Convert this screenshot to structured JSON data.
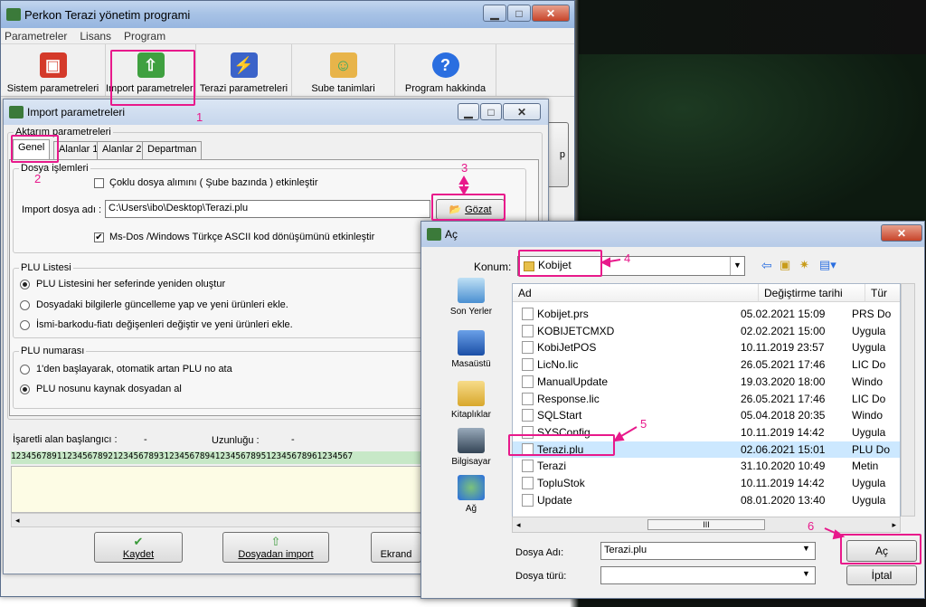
{
  "main_window": {
    "title": "Perkon Terazi yönetim programi",
    "menu": [
      "Parametreler",
      "Lisans",
      "Program"
    ],
    "toolbar": [
      {
        "label": "Sistem parametreleri",
        "icon": "toolbox-icon"
      },
      {
        "label": "Import parametreleri",
        "icon": "import-arrow-icon"
      },
      {
        "label": "Terazi parametreleri",
        "icon": "scale-plug-icon"
      },
      {
        "label": "Sube tanimlari",
        "icon": "users-icon"
      },
      {
        "label": "Program hakkinda",
        "icon": "help-icon"
      }
    ],
    "edge_button_label": "p"
  },
  "import_window": {
    "title": "Import parametreleri",
    "group_title": "Aktarım parametreleri",
    "tabs": [
      "Genel",
      "Alanlar 1",
      "Alanlar 2",
      "Departman"
    ],
    "dosya": {
      "title": "Dosya işlemleri",
      "multi_file_label": "Çoklu dosya alımını ( Şube bazında ) etkinleştir",
      "import_file_label": "Import dosya adı :",
      "import_file_value": "C:\\Users\\ibo\\Desktop\\Terazi.plu",
      "browse_label": "Gözat",
      "msdos_label": "Ms-Dos /Windows Türkçe ASCII kod dönüşümünü etkinleştir"
    },
    "plu_list": {
      "title": "PLU Listesi",
      "options": [
        "PLU Listesini her seferinde yeniden oluştur",
        "Dosyadaki bilgilerle güncelleme yap ve yeni ürünleri ekle.",
        "İsmi-barkodu-fiatı değişenleri değiştir ve yeni ürünleri ekle."
      ]
    },
    "plu_num": {
      "title": "PLU numarası",
      "options": [
        "1'den başlayarak, otomatik artan PLU no ata",
        "PLU nosunu kaynak dosyadan al"
      ]
    },
    "field_start_label": "İşaretli alan başlangıcı :",
    "field_start_value": "-",
    "length_label": "Uzunluğu :",
    "length_value": "-",
    "ruler": "1234567891123456789212345678931234567894123456789512345678961234567",
    "buttons": {
      "save": "Kaydet",
      "import": "Dosyadan import",
      "screen": "Ekrand"
    }
  },
  "open_dialog": {
    "title": "Aç",
    "location_label": "Konum:",
    "location_value": "Kobijet",
    "places": [
      "Son Yerler",
      "Masaüstü",
      "Kitaplıklar",
      "Bilgisayar",
      "Ağ"
    ],
    "columns": [
      "Ad",
      "Değiştirme tarihi",
      "Tür"
    ],
    "files": [
      {
        "name": "Kobijet.prs",
        "date": "05.02.2021 15:09",
        "type": "PRS Do"
      },
      {
        "name": "KOBIJETCMXD",
        "date": "02.02.2021 15:00",
        "type": "Uygula"
      },
      {
        "name": "KobiJetPOS",
        "date": "10.11.2019 23:57",
        "type": "Uygula"
      },
      {
        "name": "LicNo.lic",
        "date": "26.05.2021 17:46",
        "type": "LIC Do"
      },
      {
        "name": "ManualUpdate",
        "date": "19.03.2020 18:00",
        "type": "Windo"
      },
      {
        "name": "Response.lic",
        "date": "26.05.2021 17:46",
        "type": "LIC Do"
      },
      {
        "name": "SQLStart",
        "date": "05.04.2018 20:35",
        "type": "Windo"
      },
      {
        "name": "SYSConfig",
        "date": "10.11.2019 14:42",
        "type": "Uygula"
      },
      {
        "name": "Terazi.plu",
        "date": "02.06.2021 15:01",
        "type": "PLU Do"
      },
      {
        "name": "Terazi",
        "date": "31.10.2020 10:49",
        "type": "Metin"
      },
      {
        "name": "TopluStok",
        "date": "10.11.2019 14:42",
        "type": "Uygula"
      },
      {
        "name": "Update",
        "date": "08.01.2020 13:40",
        "type": "Uygula"
      }
    ],
    "filename_label": "Dosya Adı:",
    "filename_value": "Terazi.plu",
    "filetype_label": "Dosya türü:",
    "filetype_value": "",
    "open_button": "Aç",
    "cancel_button": "İptal",
    "scroll_mark": "III"
  },
  "annotations": [
    "1",
    "2",
    "3",
    "4",
    "5",
    "6"
  ],
  "colors": {
    "highlight": "#e8198b",
    "selection": "#cce8ff"
  }
}
